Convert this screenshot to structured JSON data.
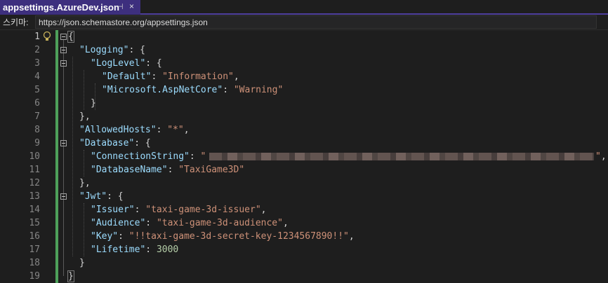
{
  "tab": {
    "title": "appsettings.AzureDev.json",
    "pin_glyph": "⊣",
    "close_glyph": "×"
  },
  "schema": {
    "label": "스키마:",
    "url": "https://json.schemastore.org/appsettings.json"
  },
  "colors": {
    "key": "#9cdcfe",
    "string": "#ce9178",
    "number": "#b5cea8",
    "punct": "#d4d4d4",
    "linenum": "#858585",
    "changebar": "#4ea05a",
    "tab": "#3d2f7e"
  },
  "icons": {
    "lightbulb": "lightbulb-icon",
    "fold": "collapse-icon"
  },
  "lines": {
    "l1": {
      "num": "1",
      "brace": "{"
    },
    "l2": {
      "num": "2",
      "key": "\"Logging\"",
      "rest": ": {"
    },
    "l3": {
      "num": "3",
      "key": "\"LogLevel\"",
      "rest": ": {"
    },
    "l4": {
      "num": "4",
      "key": "\"Default\"",
      "sep": ": ",
      "val": "\"Information\"",
      "end": ","
    },
    "l5": {
      "num": "5",
      "key": "\"Microsoft.AspNetCore\"",
      "sep": ": ",
      "val": "\"Warning\""
    },
    "l6": {
      "num": "6",
      "text": "}"
    },
    "l7": {
      "num": "7",
      "text": "},"
    },
    "l8": {
      "num": "8",
      "key": "\"AllowedHosts\"",
      "sep": ": ",
      "val": "\"*\"",
      "end": ","
    },
    "l9": {
      "num": "9",
      "key": "\"Database\"",
      "rest": ": {"
    },
    "l10": {
      "num": "10",
      "key": "\"ConnectionString\"",
      "sep": ": ",
      "val_open": "\"",
      "val_close": "\"",
      "end": ","
    },
    "l11": {
      "num": "11",
      "key": "\"DatabaseName\"",
      "sep": ": ",
      "val": "\"TaxiGame3D\""
    },
    "l12": {
      "num": "12",
      "text": "},"
    },
    "l13": {
      "num": "13",
      "key": "\"Jwt\"",
      "rest": ": {"
    },
    "l14": {
      "num": "14",
      "key": "\"Issuer\"",
      "sep": ": ",
      "val": "\"taxi-game-3d-issuer\"",
      "end": ","
    },
    "l15": {
      "num": "15",
      "key": "\"Audience\"",
      "sep": ": ",
      "val": "\"taxi-game-3d-audience\"",
      "end": ","
    },
    "l16": {
      "num": "16",
      "key": "\"Key\"",
      "sep": ": ",
      "val": "\"!!taxi-game-3d-secret-key-1234567890!!\"",
      "end": ","
    },
    "l17": {
      "num": "17",
      "key": "\"Lifetime\"",
      "sep": ": ",
      "num_val": "3000"
    },
    "l18": {
      "num": "18",
      "text": "}"
    },
    "l19": {
      "num": "19",
      "brace": "}"
    }
  }
}
